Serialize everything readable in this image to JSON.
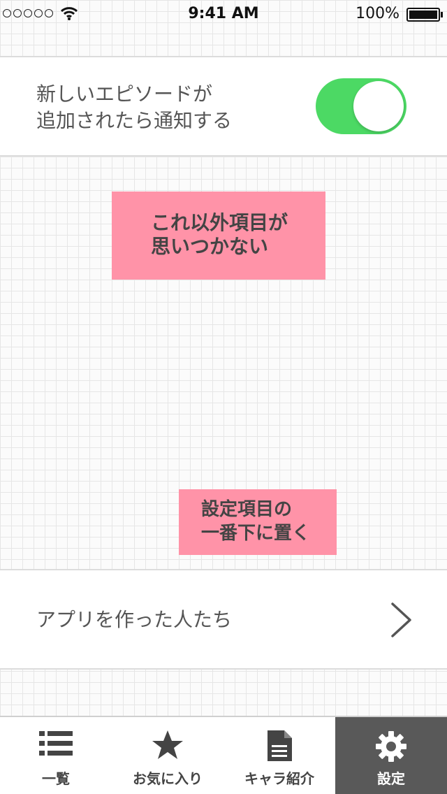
{
  "status_bar": {
    "time": "9:41 AM",
    "battery_percent": "100%",
    "signal_dots": 5
  },
  "settings": {
    "notify_label": "新しいエピソードが\n追加されたら通知する",
    "notify_enabled": true,
    "toggle_color": "#4cd964",
    "about_label": "アプリを作った人たち"
  },
  "notes": {
    "note1": "これ以外項目が\n思いつかない",
    "note2": "設定項目の\n一番下に置く",
    "note_color": "#ff93a8"
  },
  "tab_bar": {
    "tabs": [
      {
        "label": "一覧",
        "icon": "list-icon",
        "active": false
      },
      {
        "label": "お気に入り",
        "icon": "star-icon",
        "active": false
      },
      {
        "label": "キャラ紹介",
        "icon": "document-icon",
        "active": false
      },
      {
        "label": "設定",
        "icon": "gear-icon",
        "active": true
      }
    ],
    "active_color": "#595959"
  }
}
